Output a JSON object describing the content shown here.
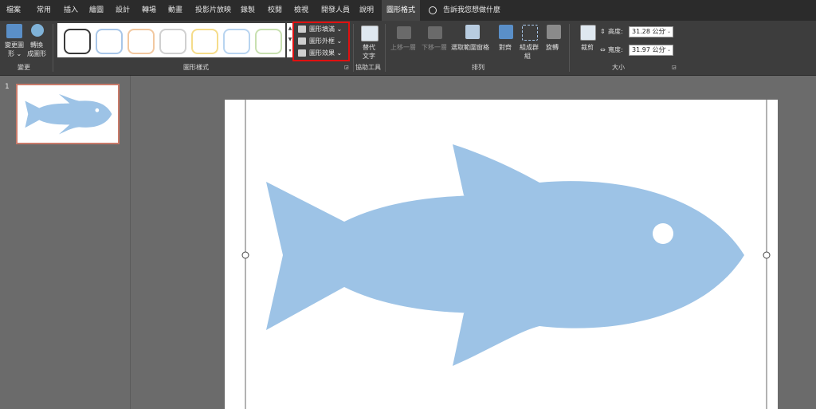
{
  "tabs": [
    {
      "label": "檔案"
    },
    {
      "label": "常用"
    },
    {
      "label": "插入"
    },
    {
      "label": "繪圖"
    },
    {
      "label": "設計"
    },
    {
      "label": "轉場"
    },
    {
      "label": "動畫"
    },
    {
      "label": "投影片放映"
    },
    {
      "label": "錄製"
    },
    {
      "label": "校閱"
    },
    {
      "label": "檢視"
    },
    {
      "label": "開發人員"
    },
    {
      "label": "說明"
    },
    {
      "label": "圖形格式",
      "active": true
    }
  ],
  "tell_me": "告訴我您想做什麼",
  "ribbon": {
    "change_shape_group": {
      "change_shape_line1": "變更圖",
      "change_shape_line2": "形 ⌄",
      "convert_line1": "轉換",
      "convert_line2": "成圖形",
      "group_label": "變更"
    },
    "shape_styles": {
      "group_label": "圖形樣式",
      "fill_label": "圖形填滿 ⌄",
      "outline_label": "圖形外框 ⌄",
      "effects_label": "圖形效果 ⌄"
    },
    "accessibility": {
      "alt_text_line1": "替代",
      "alt_text_line2": "文字",
      "group_label": "協助工具"
    },
    "arrange": {
      "bring_forward": "上移一層",
      "send_backward": "下移一層",
      "selection_pane": "選取範圍窗格",
      "align": "對齊",
      "group_line1": "組成群",
      "group_line2": "組",
      "rotate": "旋轉",
      "group_label": "排列"
    },
    "size": {
      "crop": "裁剪",
      "height_label": "高度:",
      "height_value": "31.28 公分",
      "width_label": "寬度:",
      "width_value": "31.97 公分",
      "group_label": "大小"
    }
  },
  "slides_pane": {
    "slide_number": "1"
  },
  "colors": {
    "fish_fill": "#9dc3e6",
    "highlight_box": "#e01010",
    "ribbon_bg": "#3d3d3d",
    "tabbar_bg": "#2b2b2b",
    "workspace_bg": "#6b6b6b"
  },
  "icons": [
    "change-shape-icon",
    "convert-icon",
    "fill-icon",
    "outline-icon",
    "effects-icon",
    "alt-text-icon",
    "bring-forward-icon",
    "send-backward-icon",
    "selection-pane-icon",
    "align-icon",
    "group-icon",
    "rotate-icon",
    "crop-icon",
    "height-icon",
    "width-icon",
    "lightbulb-icon"
  ]
}
